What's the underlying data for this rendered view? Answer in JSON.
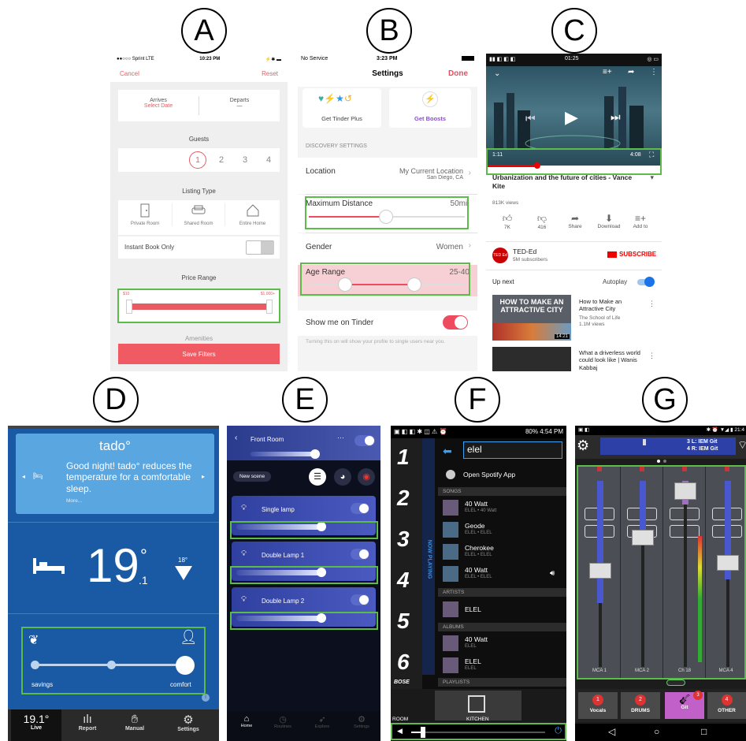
{
  "labels": [
    "A",
    "B",
    "C",
    "D",
    "E",
    "F",
    "G"
  ],
  "a": {
    "status_left": "●●○○○ Sprint  LTE",
    "status_time": "10:23 PM",
    "status_right": "⚡✱ ▬",
    "cancel": "Cancel",
    "reset": "Reset",
    "arrives": "Arrives",
    "select_date": "Select Date",
    "departs": "Departs",
    "departs_value": "—",
    "guests": "Guests",
    "guest_options": [
      "1",
      "2",
      "3",
      "4"
    ],
    "listing_type": "Listing Type",
    "listing_options": [
      "Private Room",
      "Shared Room",
      "Entire Home"
    ],
    "instant_book": "Instant Book Only",
    "price_range": "Price Range",
    "price_min": "$10",
    "price_max": "$1,000+",
    "amenities": "Amenities",
    "save_filters": "Save Filters"
  },
  "b": {
    "status_left": "No Service",
    "status_time": "3:23 PM",
    "title": "Settings",
    "done": "Done",
    "get_plus": "Get Tinder Plus",
    "get_boosts": "Get Boosts",
    "discovery": "DISCOVERY SETTINGS",
    "location": "Location",
    "location_value": "My Current Location",
    "location_sub": "San Diego, CA",
    "max_distance": "Maximum Distance",
    "max_distance_value": "50mi.",
    "gender": "Gender",
    "gender_value": "Women",
    "age_range": "Age Range",
    "age_range_value": "25-40",
    "show_me": "Show me on Tinder",
    "show_me_note": "Turning this on will show your profile to single users near you."
  },
  "c": {
    "status_time": "01:25",
    "time_current": "1:11",
    "time_total": "4:08",
    "title": "Urbanization and the future of cities - Vance Kite",
    "views": "813K views",
    "actions": [
      {
        "label": "7K",
        "icon": "thumbs-up-icon"
      },
      {
        "label": "416",
        "icon": "thumbs-down-icon"
      },
      {
        "label": "Share",
        "icon": "share-icon"
      },
      {
        "label": "Download",
        "icon": "download-icon"
      },
      {
        "label": "Add to",
        "icon": "add-to-playlist-icon"
      }
    ],
    "channel": "TED-Ed",
    "channel_logo": "TED Ed",
    "subscribers": "5M subscribers",
    "subscribe": "SUBSCRIBE",
    "up_next": "Up next",
    "autoplay": "Autoplay",
    "video1_thumb": "HOW TO MAKE AN ATTRACTIVE CITY",
    "video1_title": "How to Make an Attractive City",
    "video1_channel": "The School of Life",
    "video1_views": "1.1M views",
    "video1_duration": "14:21",
    "video2_title": "What a driverless world could look like | Wanis Kabbaj"
  },
  "d": {
    "logo": "tado°",
    "message": "Good night! tado° reduces the temperature for a comfortable sleep.",
    "more": "More...",
    "temp_main": "19",
    "temp_deg": "°",
    "temp_decimal": ".1",
    "target": "18°",
    "savings": "savings",
    "comfort": "comfort",
    "tabs": [
      {
        "label": "Live",
        "value": "19.1°"
      },
      {
        "label": "Report",
        "icon": "bar-chart-icon"
      },
      {
        "label": "Manual",
        "icon": "hand-icon"
      },
      {
        "label": "Settings",
        "icon": "gear-icon"
      }
    ]
  },
  "e": {
    "room": "Front Room",
    "new_scene": "New scene",
    "lamps": [
      "Single lamp",
      "Double Lamp 1",
      "Double Lamp 2"
    ],
    "tabs": [
      "Home",
      "Routines",
      "Explore",
      "Settings"
    ]
  },
  "f": {
    "status": "80% 4:54 PM",
    "search": "elel",
    "open_spotify": "Open Spotify App",
    "now_playing": "NOW PLAYING",
    "numbers": [
      "1",
      "2",
      "3",
      "4",
      "5",
      "6"
    ],
    "songs_header": "SONGS",
    "songs": [
      {
        "title": "40 Watt",
        "sub": "ELEL • 40 Watt"
      },
      {
        "title": "Geode",
        "sub": "ELEL • ELEL"
      },
      {
        "title": "Cherokee",
        "sub": "ELEL • ELEL"
      },
      {
        "title": "40 Watt",
        "sub": "ELEL • ELEL"
      }
    ],
    "artists_header": "ARTISTS",
    "artist": "ELEL",
    "albums_header": "ALBUMS",
    "albums": [
      {
        "title": "40 Watt",
        "sub": "ELEL"
      },
      {
        "title": "ELEL",
        "sub": "ELEL"
      }
    ],
    "playlists_header": "PLAYLISTS",
    "bose": "BOSE",
    "room_left": "ROOM",
    "room": "KITCHEN"
  },
  "g": {
    "status_time": "21:4",
    "line1": "3 L: IEM Git",
    "line2": "4 R: IEM Git",
    "channels": [
      "MCA 1",
      "MCA 2",
      "Ch 18",
      "MCA 4"
    ],
    "buttons": [
      {
        "num": "1",
        "label": "Vocals"
      },
      {
        "num": "2",
        "label": "DRUMS"
      },
      {
        "num": "3",
        "label": "Git"
      },
      {
        "num": "4",
        "label": "OTHER"
      }
    ]
  }
}
